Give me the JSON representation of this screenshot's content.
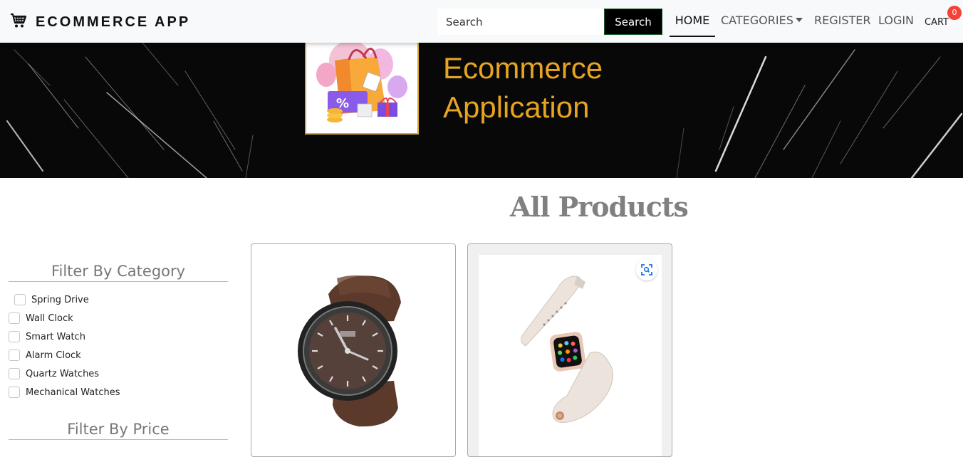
{
  "app": {
    "brand": "ECOMMERCE APP"
  },
  "search": {
    "placeholder": "Search",
    "button_label": "Search"
  },
  "nav": {
    "home": "HOME",
    "categories": "CATEGORIES",
    "register": "REGISTER",
    "login": "LOGIN",
    "cart": "CART",
    "cart_count": "0"
  },
  "banner": {
    "line1": "Ecommerce",
    "line2": "Application"
  },
  "main": {
    "heading": "All Products"
  },
  "filters": {
    "category_heading": "Filter By Category",
    "categories": [
      "Spring Drive",
      "Wall Clock",
      "Smart Watch",
      "Alarm Clock",
      "Quartz Watches",
      "Mechanical Watches"
    ],
    "price_heading": "Filter By Price"
  },
  "products": [
    {
      "image": "brown-wristwatch"
    },
    {
      "image": "white-smart-watch"
    }
  ],
  "colors": {
    "brand_gold": "#e6a421",
    "badge_red": "#f44336",
    "heading_gray": "#808080"
  },
  "icons": {
    "brand": "shopping-cart-icon",
    "dropdown": "caret-down-icon",
    "zoom": "zoom-scan-icon"
  }
}
